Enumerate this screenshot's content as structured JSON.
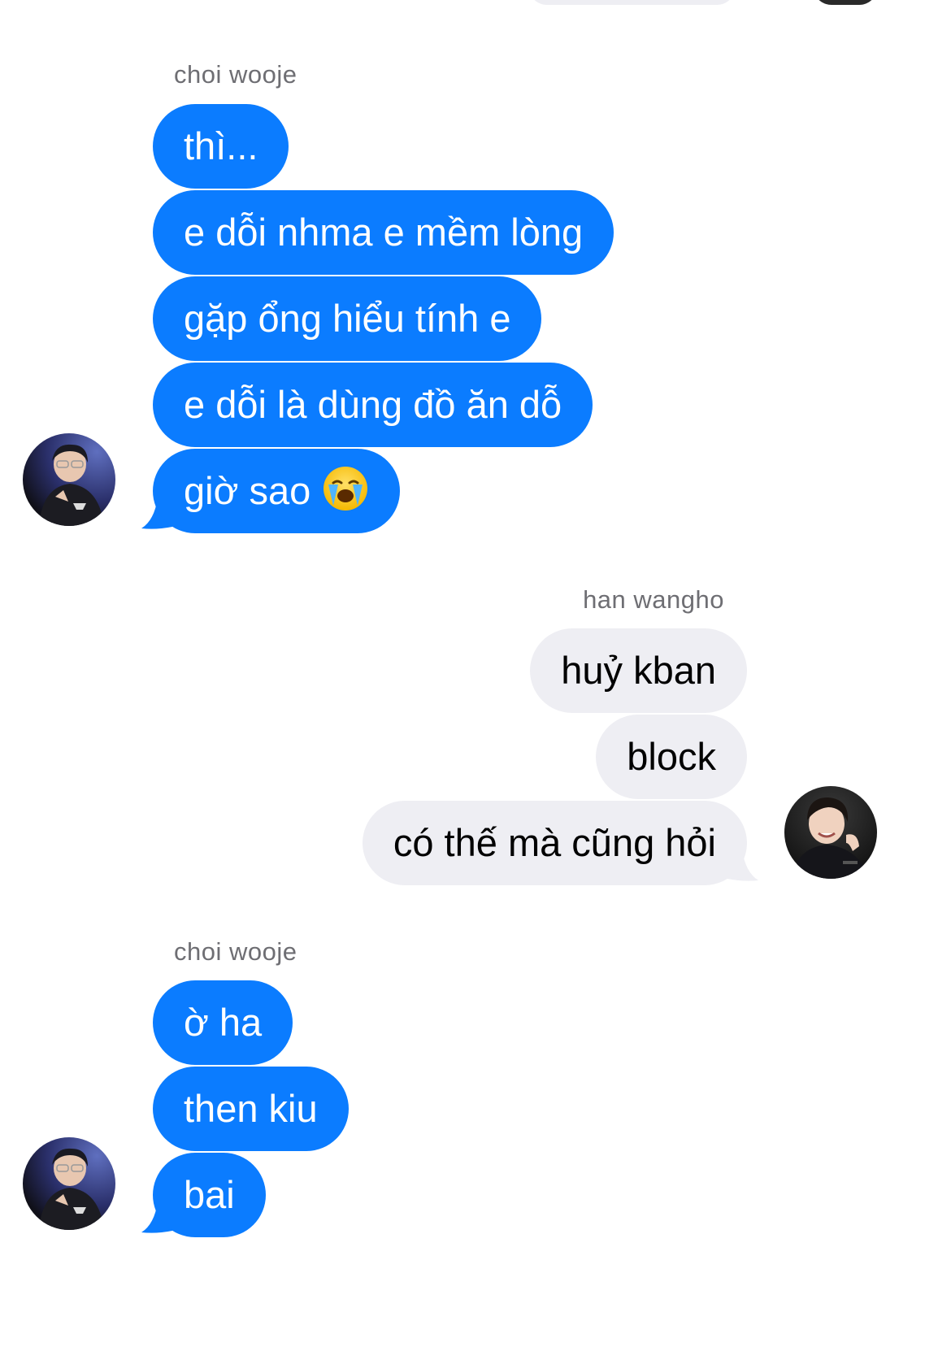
{
  "conversation": {
    "groups": [
      {
        "sender": "choi wooje",
        "side": "left",
        "messages": [
          "thì...",
          "e dỗi nhma e mềm lòng",
          "gặp ổng hiểu tính e",
          "e dỗi là dùng đồ ăn dỗ",
          "giờ sao"
        ]
      },
      {
        "sender": "han wangho",
        "side": "right",
        "messages": [
          "huỷ kban",
          "block",
          "có thế mà cũng hỏi"
        ]
      },
      {
        "sender": "choi wooje",
        "side": "left",
        "messages": [
          "ờ ha",
          "then kiu",
          "bai"
        ]
      }
    ],
    "emoji": "loudly-crying-face"
  },
  "colors": {
    "outgoing_bubble": "#0b7cff",
    "incoming_bubble": "#eeeef3",
    "sender_name": "#6e6e73"
  }
}
